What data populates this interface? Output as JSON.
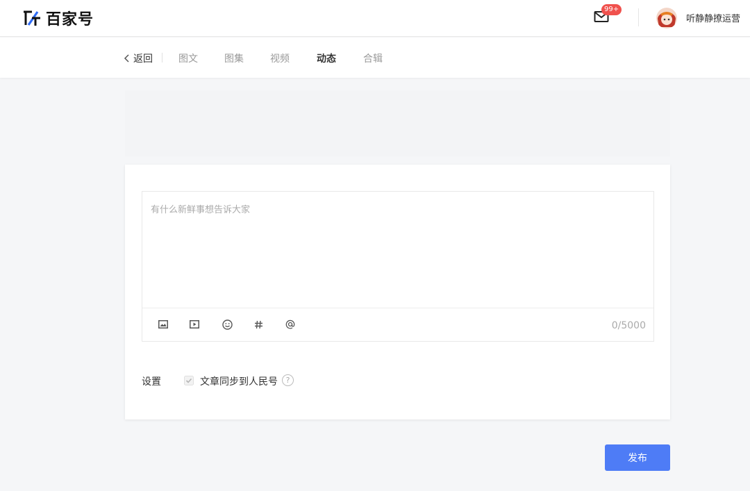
{
  "header": {
    "logo_text": "百家号",
    "mail_badge": "99+",
    "username": "听静静撩运营"
  },
  "subnav": {
    "back_label": "返回",
    "tabs": [
      {
        "label": "图文",
        "active": false
      },
      {
        "label": "图集",
        "active": false
      },
      {
        "label": "视频",
        "active": false
      },
      {
        "label": "动态",
        "active": true
      },
      {
        "label": "合辑",
        "active": false
      }
    ]
  },
  "editor": {
    "placeholder": "有什么新鲜事想告诉大家",
    "value": "",
    "count": "0/5000",
    "tools": [
      "image-icon",
      "video-icon",
      "emoji-icon",
      "hashtag-icon",
      "at-icon"
    ]
  },
  "settings": {
    "label": "设置",
    "sync_label": "文章同步到人民号",
    "sync_checked": true,
    "help_symbol": "?"
  },
  "publish_label": "发布",
  "colors": {
    "accent": "#4e7cf6",
    "badge": "#f0514d",
    "background": "#f5f6f8"
  }
}
